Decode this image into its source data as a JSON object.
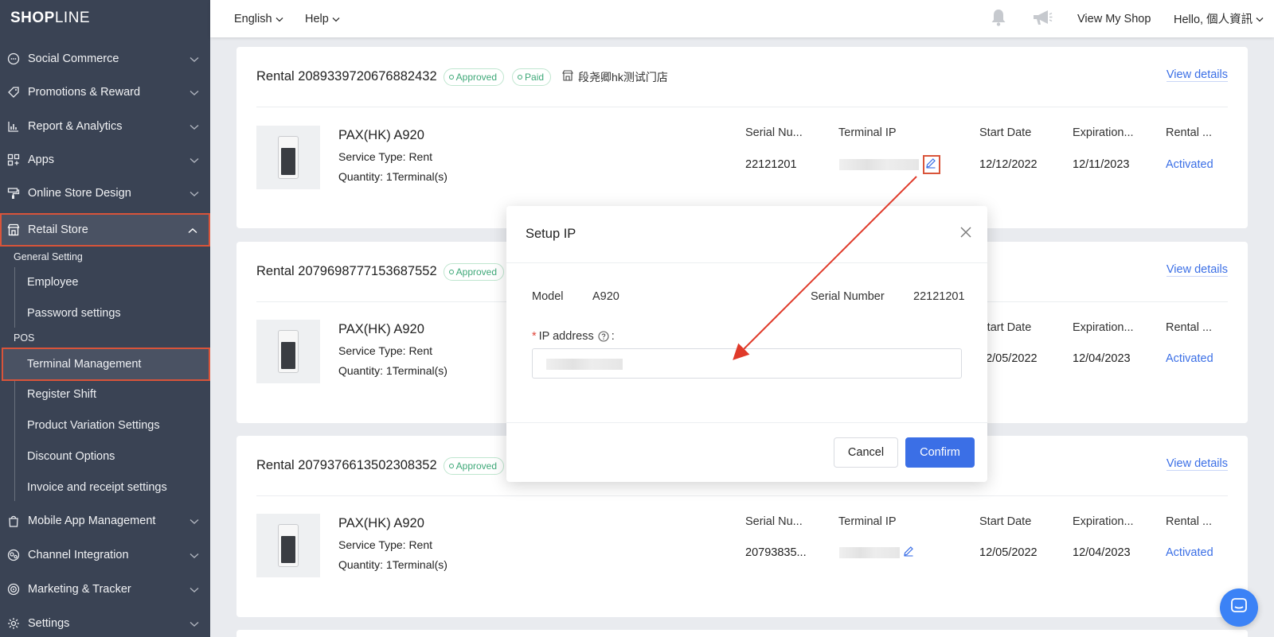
{
  "app": {
    "logo_bold": "SHOP",
    "logo_thin": "LINE"
  },
  "sidebar": {
    "items": [
      {
        "label": "Social Commerce",
        "icon": "chat-bubble-icon"
      },
      {
        "label": "Promotions & Reward",
        "icon": "tag-icon"
      },
      {
        "label": "Report & Analytics",
        "icon": "bar-chart-icon"
      },
      {
        "label": "Apps",
        "icon": "apps-grid-icon"
      },
      {
        "label": "Online Store Design",
        "icon": "paint-roller-icon"
      },
      {
        "label": "Retail Store",
        "icon": "store-icon"
      }
    ],
    "retail_groups": {
      "general_label": "General Setting",
      "general_items": [
        "Employee",
        "Password settings"
      ],
      "pos_label": "POS",
      "pos_items": [
        "Terminal Management",
        "Register Shift",
        "Product Variation Settings",
        "Discount Options",
        "Invoice and receipt settings"
      ]
    },
    "bottom_items": [
      {
        "label": "Mobile App Management",
        "icon": "mobile-bag-icon"
      },
      {
        "label": "Channel Integration",
        "icon": "globe-icon"
      },
      {
        "label": "Marketing & Tracker",
        "icon": "target-icon"
      },
      {
        "label": "Settings",
        "icon": "gear-icon"
      }
    ]
  },
  "topbar": {
    "language": "English",
    "help": "Help",
    "view_shop": "View My Shop",
    "greeting": "Hello, 個人資訊"
  },
  "rentals": [
    {
      "title": "Rental 2089339720676882432",
      "badges": [
        "Approved",
        "Paid"
      ],
      "store": "段尧卿hk测试门店",
      "view_details": "View details",
      "product": "PAX(HK) A920",
      "service": "Service Type: Rent",
      "quantity": "Quantity: 1Terminal(s)",
      "serial": "22121201",
      "start": "12/12/2022",
      "expiration": "12/11/2023",
      "status": "Activated"
    },
    {
      "title": "Rental 2079698777153687552",
      "badges": [
        "Approved"
      ],
      "view_details": "View details",
      "product": "PAX(HK) A920",
      "service": "Service Type: Rent",
      "quantity": "Quantity: 1Terminal(s)",
      "start": "12/05/2022",
      "expiration": "12/04/2023",
      "status": "Activated"
    },
    {
      "title": "Rental 2079376613502308352",
      "badges": [
        "Approved"
      ],
      "view_details": "View details",
      "product": "PAX(HK) A920",
      "service": "Service Type: Rent",
      "quantity": "Quantity: 1Terminal(s)",
      "serial": "20793835...",
      "start": "12/05/2022",
      "expiration": "12/04/2023",
      "status": "Activated"
    }
  ],
  "columns": {
    "serial": "Serial Nu...",
    "terminal_ip": "Terminal IP",
    "start": "Start Date",
    "expiration": "Expiration...",
    "rental": "Rental ..."
  },
  "modal": {
    "title": "Setup IP",
    "model_label": "Model",
    "model_value": "A920",
    "serial_label": "Serial Number",
    "serial_value": "22121201",
    "required_mark": "*",
    "ip_label": "IP address",
    "ip_colon": ":",
    "cancel": "Cancel",
    "confirm": "Confirm"
  },
  "colors": {
    "accent": "#3b6fe6",
    "sidebar_bg": "#3a4354",
    "highlight": "#d9543a",
    "approved": "#3ea878"
  }
}
